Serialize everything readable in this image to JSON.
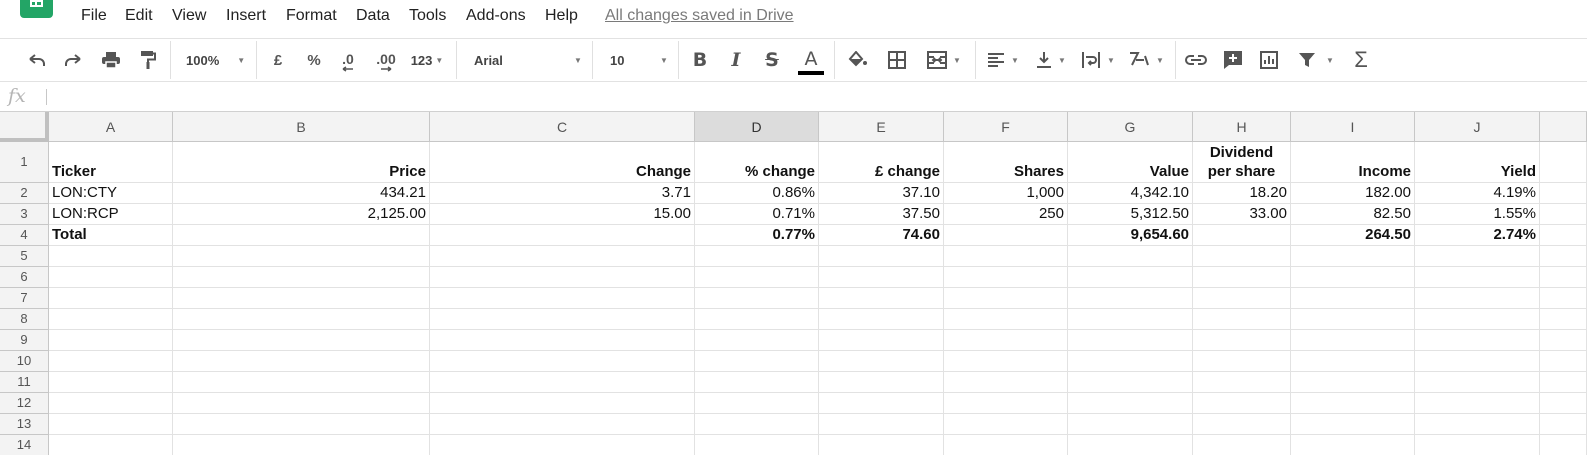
{
  "menu": {
    "items": [
      "File",
      "Edit",
      "View",
      "Insert",
      "Format",
      "Data",
      "Tools",
      "Add-ons",
      "Help"
    ],
    "save_status": "All changes saved in Drive"
  },
  "toolbar": {
    "zoom": "100%",
    "currency_symbol": "£",
    "percent_symbol": "%",
    "decrease_decimal": ".0",
    "increase_decimal": ".00",
    "more_formats": "123",
    "font_name": "Arial",
    "font_size": "10",
    "bold_label": "B",
    "italic_label": "I",
    "strike_label": "S",
    "text_color_label": "A",
    "function_label": "Σ"
  },
  "formula_bar": {
    "fx_label": "fx",
    "value": ""
  },
  "sheet": {
    "active_column": "D",
    "columns": [
      "A",
      "B",
      "C",
      "D",
      "E",
      "F",
      "G",
      "H",
      "I",
      "J"
    ],
    "row_numbers": [
      "1",
      "2",
      "3",
      "4",
      "5",
      "6",
      "7",
      "8",
      "9",
      "10",
      "11",
      "12",
      "13",
      "14"
    ],
    "header_row": {
      "ticker": "Ticker",
      "price": "Price",
      "change": "Change",
      "pct_change": "% change",
      "gbp_change": "£ change",
      "shares": "Shares",
      "value": "Value",
      "dividend_line1": "Dividend",
      "dividend_line2": "per share",
      "income": "Income",
      "yield": "Yield"
    },
    "rows": [
      [
        "LON:CTY",
        "434.21",
        "3.71",
        "0.86%",
        "37.10",
        "1,000",
        "4,342.10",
        "18.20",
        "182.00",
        "4.19%"
      ],
      [
        "LON:RCP",
        "2,125.00",
        "15.00",
        "0.71%",
        "37.50",
        "250",
        "5,312.50",
        "33.00",
        "82.50",
        "1.55%"
      ]
    ],
    "total_row": [
      "Total",
      "",
      "",
      "0.77%",
      "74.60",
      "",
      "9,654.60",
      "",
      "264.50",
      "2.74%"
    ]
  },
  "colors": {
    "brand_green": "#23a566",
    "text_color_bar": "#000000",
    "header_bg": "#f3f3f3",
    "active_header_bg": "#dcdcdc"
  }
}
